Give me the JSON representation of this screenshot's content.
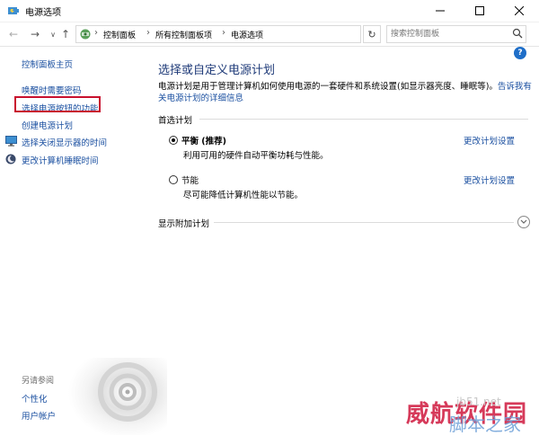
{
  "window": {
    "title": "电源选项",
    "controls": {
      "minimize_icon": "minimize-icon",
      "maximize_icon": "maximize-icon",
      "close_icon": "close-icon"
    }
  },
  "address_bar": {
    "breadcrumbs": [
      "控制面板",
      "所有控制面板项",
      "电源选项"
    ],
    "search_placeholder": "搜索控制面板"
  },
  "sidebar": {
    "home": "控制面板主页",
    "links": [
      {
        "label": "唤醒时需要密码"
      },
      {
        "label": "选择电源按钮的功能",
        "highlighted": true
      },
      {
        "label": "创建电源计划"
      },
      {
        "label": "选择关闭显示器的时间",
        "icon": "monitor-icon"
      },
      {
        "label": "更改计算机睡眠时间",
        "icon": "moon-icon"
      }
    ],
    "see_also": {
      "heading": "另请参阅",
      "links": [
        "个性化",
        "用户帐户"
      ]
    }
  },
  "main": {
    "title": "选择或自定义电源计划",
    "description": "电源计划是用于管理计算机如何使用电源的一套硬件和系统设置(如显示器亮度、睡眠等)。",
    "description_link": "告诉我有关电源计划的详细信息",
    "preferred_label": "首选计划",
    "plans": [
      {
        "name": "平衡 (推荐)",
        "description": "利用可用的硬件自动平衡功耗与性能。",
        "change_link": "更改计划设置",
        "selected": true
      },
      {
        "name": "节能",
        "description": "尽可能降低计算机性能以节能。",
        "change_link": "更改计划设置",
        "selected": false
      }
    ],
    "more_label": "显示附加计划"
  },
  "watermark": {
    "big_text": "威航软件园",
    "site": "jb51.net",
    "script_text": "脚本之家"
  },
  "colors": {
    "link": "#1a4fa0",
    "title": "#1e3a78",
    "highlight": "#c8102e"
  }
}
